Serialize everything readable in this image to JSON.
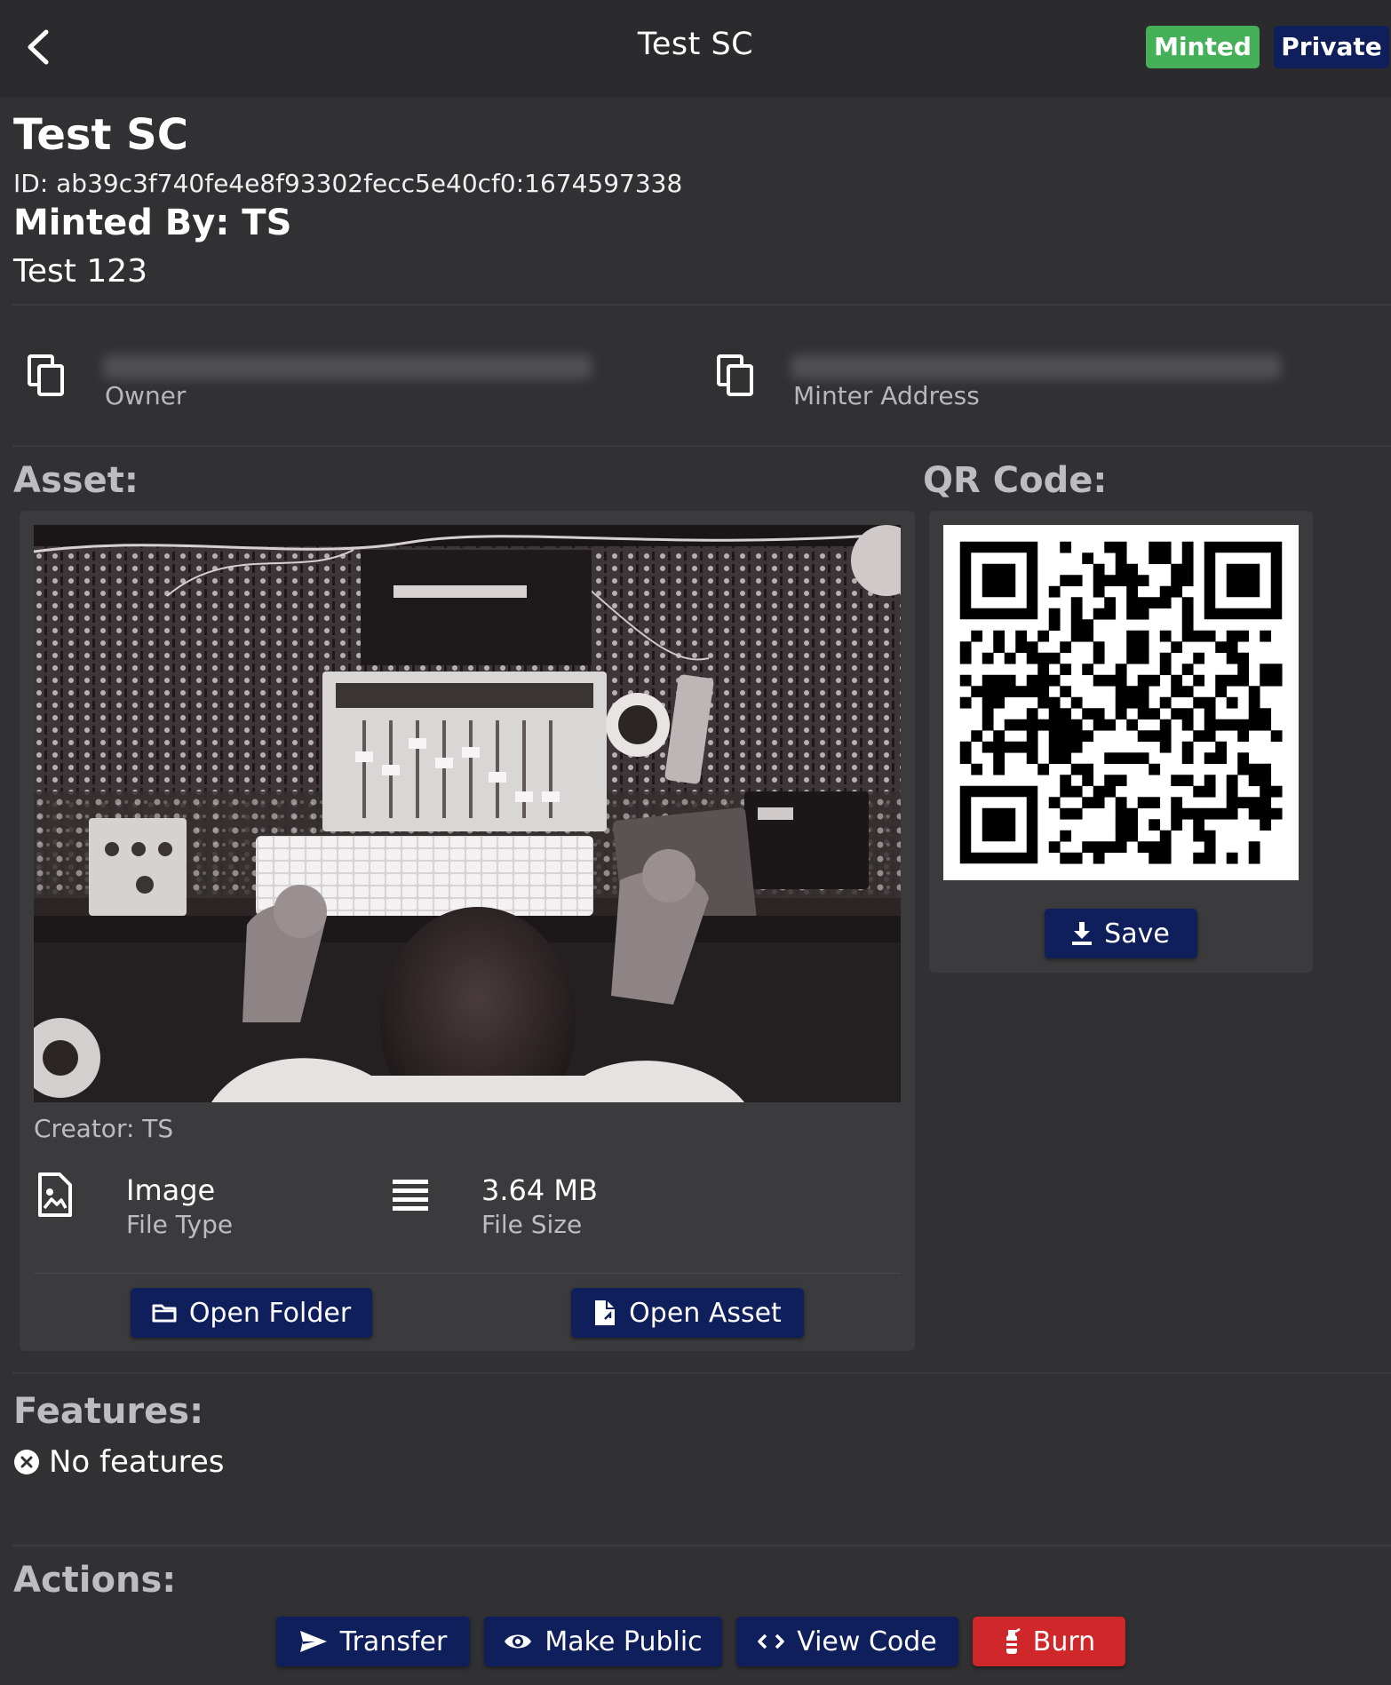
{
  "header": {
    "title": "Test SC",
    "badges": {
      "minted": "Minted",
      "private": "Private"
    },
    "colors": {
      "minted": "#46b058",
      "private": "#0f1f5c"
    }
  },
  "token": {
    "title": "Test SC",
    "id_line": "ID: ab39c3f740fe4e8f93302fecc5e40cf0:1674597338",
    "minted_by": "Minted By: TS",
    "description": "Test 123"
  },
  "addresses": {
    "owner_label": "Owner",
    "minter_label": "Minter Address",
    "icon": "copy-icon"
  },
  "asset": {
    "section_label": "Asset:",
    "creator": "Creator: TS",
    "file_type_value": "Image",
    "file_type_label": "File Type",
    "file_size_value": "3.64 MB",
    "file_size_label": "File Size",
    "open_folder": "Open Folder",
    "open_asset": "Open Asset"
  },
  "qr": {
    "section_label": "QR Code:",
    "save": "Save"
  },
  "features": {
    "section_label": "Features:",
    "empty": "No features"
  },
  "actions": {
    "section_label": "Actions:",
    "transfer": "Transfer",
    "make_public": "Make Public",
    "view_code": "View Code",
    "burn": "Burn",
    "colors": {
      "primary": "#0f1f5c",
      "danger": "#d0282a"
    }
  }
}
